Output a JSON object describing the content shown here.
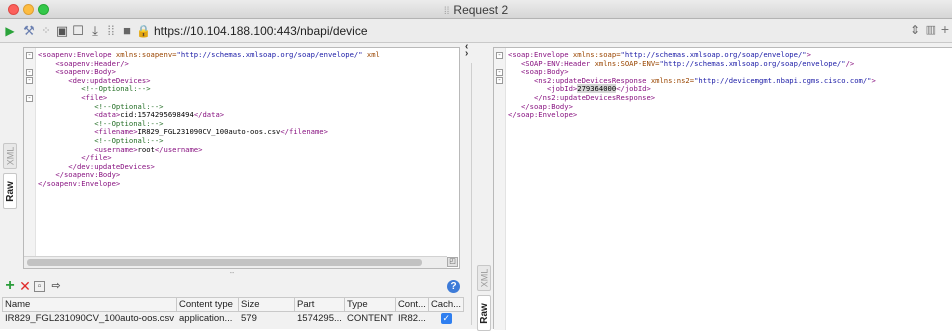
{
  "window": {
    "title": "Request 2",
    "title_icon": "soapui-icon"
  },
  "toolbar": {
    "url": "https://10.104.188.100:443/nbapi/device",
    "icons": [
      "play-icon",
      "wand-icon",
      "stop-icon",
      "format-icon",
      "new-window-icon",
      "split-icon",
      "download-icon",
      "grid-icon",
      "panel-icon",
      "lock-icon"
    ],
    "right_icons": [
      "stepper-icon",
      "layout-icon",
      "plus-icon"
    ]
  },
  "left_tabs": [
    "XML",
    "Raw"
  ],
  "right_tabs": [
    "XML",
    "Raw"
  ],
  "request": {
    "lines": [
      {
        "fold": "-",
        "html": "<span class='tag'>&lt;soapenv:Envelope</span> <span class='attr'>xmlns:soapenv=</span><span class='str'>\"http://schemas.xmlsoap.org/soap/envelope/\"</span> <span class='attr'>xml</span>"
      },
      {
        "fold": "",
        "html": "    <span class='tag'>&lt;soapenv:Header/&gt;</span>"
      },
      {
        "fold": "-",
        "html": "    <span class='tag'>&lt;soapenv:Body&gt;</span>"
      },
      {
        "fold": "-",
        "html": "       <span class='tag'>&lt;dev:updateDevices&gt;</span>"
      },
      {
        "fold": "",
        "html": "          <span class='cmt'>&lt;!--Optional:--&gt;</span>"
      },
      {
        "fold": "-",
        "html": "          <span class='tag'>&lt;file&gt;</span>"
      },
      {
        "fold": "",
        "html": "             <span class='cmt'>&lt;!--Optional:--&gt;</span>"
      },
      {
        "fold": "",
        "html": "             <span class='tag'>&lt;data&gt;</span><span class='txt'>cid:1574295698494</span><span class='tag'>&lt;/data&gt;</span>"
      },
      {
        "fold": "",
        "html": "             <span class='cmt'>&lt;!--Optional:--&gt;</span>"
      },
      {
        "fold": "",
        "html": "             <span class='tag'>&lt;filename&gt;</span><span class='txt'>IR829_FGL231090CV_100auto-oos.csv</span><span class='tag'>&lt;/filename&gt;</span>"
      },
      {
        "fold": "",
        "html": "             <span class='cmt'>&lt;!--Optional:--&gt;</span>"
      },
      {
        "fold": "",
        "html": "             <span class='tag'>&lt;username&gt;</span><span class='txt'>root</span><span class='tag'>&lt;/username&gt;</span>"
      },
      {
        "fold": "",
        "html": "          <span class='tag'>&lt;/file&gt;</span>"
      },
      {
        "fold": "",
        "html": "       <span class='tag'>&lt;/dev:updateDevices&gt;</span>"
      },
      {
        "fold": "",
        "html": "    <span class='tag'>&lt;/soapenv:Body&gt;</span>"
      },
      {
        "fold": "",
        "html": "<span class='tag'>&lt;/soapenv:Envelope&gt;</span>"
      }
    ]
  },
  "response": {
    "lines": [
      {
        "fold": "-",
        "html": "<span class='tag'>&lt;soap:Envelope</span> <span class='attr'>xmlns:soap=</span><span class='str'>\"http://schemas.xmlsoap.org/soap/envelope/\"</span><span class='tag'>&gt;</span>"
      },
      {
        "fold": "",
        "html": "   <span class='tag'>&lt;SOAP-ENV:Header</span> <span class='attr'>xmlns:SOAP-ENV=</span><span class='str'>\"http://schemas.xmlsoap.org/soap/envelope/\"</span><span class='tag'>/&gt;</span>"
      },
      {
        "fold": "-",
        "html": "   <span class='tag'>&lt;soap:Body&gt;</span>"
      },
      {
        "fold": "-",
        "html": "      <span class='tag'>&lt;ns2:updateDevicesResponse</span> <span class='attr'>xmlns:ns2=</span><span class='str'>\"http://devicemgmt.nbapi.cgms.cisco.com/\"</span><span class='tag'>&gt;</span>"
      },
      {
        "fold": "",
        "html": "         <span class='tag'>&lt;jobId&gt;</span><span class='txt hl'>279364000</span><span class='tag'>&lt;/jobId&gt;</span>"
      },
      {
        "fold": "",
        "html": "      <span class='tag'>&lt;/ns2:updateDevicesResponse&gt;</span>"
      },
      {
        "fold": "",
        "html": "   <span class='tag'>&lt;/soap:Body&gt;</span>"
      },
      {
        "fold": "",
        "html": "<span class='tag'>&lt;/soap:Envelope&gt;</span>"
      }
    ]
  },
  "attachments": {
    "columns": [
      "Name",
      "Content type",
      "Size",
      "Part",
      "Type",
      "Cont...",
      "Cach..."
    ],
    "rows": [
      {
        "name": "IR829_FGL231090CV_100auto-oos.csv",
        "content_type": "application...",
        "size": "579",
        "part": "1574295...",
        "type": "CONTENT",
        "cont": "IR82...",
        "cached": true
      }
    ]
  },
  "colors": {
    "tag": "#881280",
    "attribute": "#994500",
    "string": "#1a1aa6",
    "comment": "#236e25",
    "add": "#2a9d3a",
    "delete": "#e12b2b",
    "checkbox": "#2f7ff0"
  }
}
